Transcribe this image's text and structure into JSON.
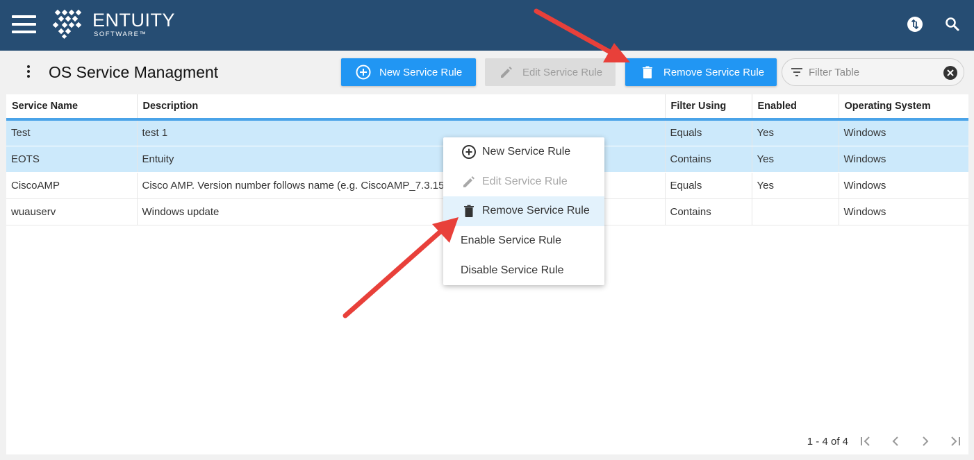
{
  "header": {
    "brand_name": "ENTUITY",
    "brand_sub": "SOFTWARE™"
  },
  "page": {
    "title": "OS Service Managment"
  },
  "toolbar": {
    "new_label": "New Service Rule",
    "edit_label": "Edit Service Rule",
    "remove_label": "Remove Service Rule",
    "filter_placeholder": "Filter Table"
  },
  "table": {
    "columns": [
      "Service Name",
      "Description",
      "Filter Using",
      "Enabled",
      "Operating System"
    ],
    "rows": [
      {
        "name": "Test",
        "description": "test 1",
        "filter": "Equals",
        "enabled": "Yes",
        "os": "Windows",
        "selected": true
      },
      {
        "name": "EOTS",
        "description": "Entuity",
        "filter": "Contains",
        "enabled": "Yes",
        "os": "Windows",
        "selected": true
      },
      {
        "name": "CiscoAMP",
        "description": "Cisco AMP. Version number follows name (e.g. CiscoAMP_7.3.15)",
        "filter": "Equals",
        "enabled": "Yes",
        "os": "Windows",
        "selected": false
      },
      {
        "name": "wuauserv",
        "description": "Windows update",
        "filter": "Contains",
        "enabled": "",
        "os": "Windows",
        "selected": false
      }
    ]
  },
  "pagination": {
    "label": "1 - 4 of 4"
  },
  "context_menu": {
    "items": [
      {
        "label": "New Service Rule",
        "icon": "add-circle-icon",
        "disabled": false
      },
      {
        "label": "Edit Service Rule",
        "icon": "pencil-icon",
        "disabled": true
      },
      {
        "label": "Remove Service Rule",
        "icon": "trash-icon",
        "disabled": false
      },
      {
        "label": "Enable Service Rule",
        "icon": "",
        "disabled": false
      },
      {
        "label": "Disable Service Rule",
        "icon": "",
        "disabled": false
      }
    ]
  },
  "colors": {
    "topbar": "#264d73",
    "primary_button": "#2196f3",
    "selected_row": "#cce9fb",
    "annotation_arrow": "#e8403a"
  }
}
